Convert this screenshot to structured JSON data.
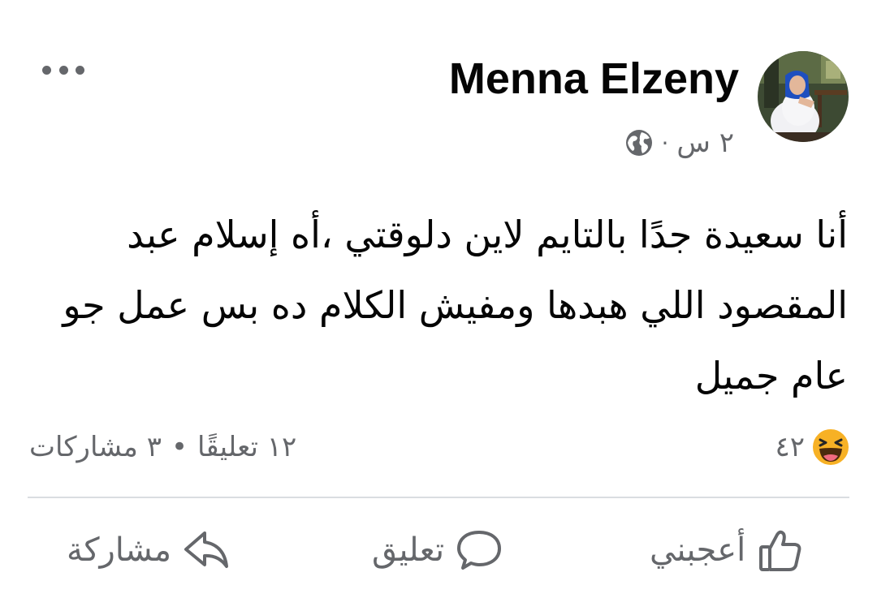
{
  "post": {
    "author": "Menna Elzeny",
    "timestamp": "٢ س",
    "separator": "·",
    "privacy_icon": "globe-icon",
    "text": "أنا سعيدة جدًا بالتايم لاين دلوقتي ،أه إسلام عبد المقصود اللي هبدها ومفيش الكلام ده بس عمل جو عام جميل"
  },
  "stats": {
    "reaction_icon": "haha-icon",
    "reaction_count": "٤٢",
    "comments": "١٢ تعليقًا",
    "bullet": "•",
    "shares": "٣ مشاركات"
  },
  "actions": {
    "like_label": "أعجبني",
    "comment_label": "تعليق",
    "share_label": "مشاركة"
  },
  "colors": {
    "text": "#050505",
    "secondary": "#65676b",
    "divider": "#dadde1",
    "haha_yellow": "#f7b125"
  }
}
